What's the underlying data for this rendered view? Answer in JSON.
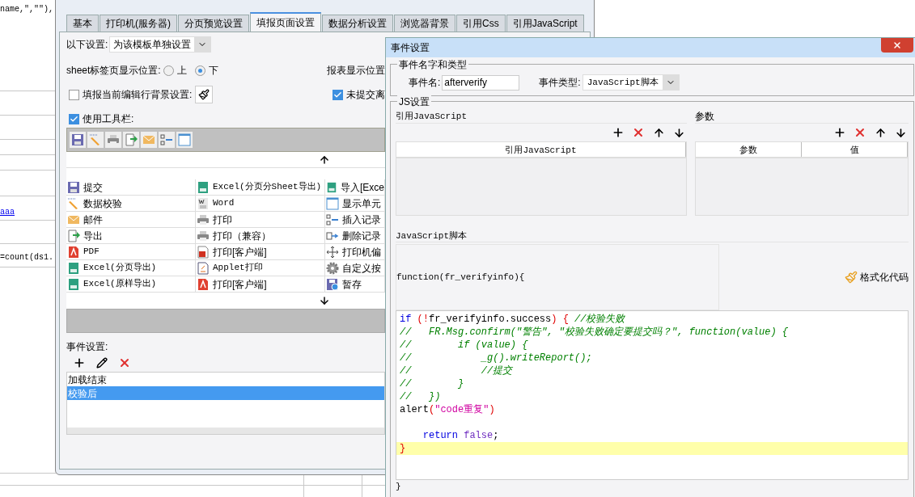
{
  "spreadsheet": {
    "cells": [
      {
        "text": "name,\",\"\"),",
        "kind": "formula"
      },
      {
        "text": "aaa",
        "kind": "link"
      },
      {
        "text": "=count(ds1.",
        "kind": "formula"
      }
    ]
  },
  "settings_window": {
    "tabs": [
      {
        "label": "基本",
        "selected": false
      },
      {
        "label": "打印机(服务器)",
        "selected": false
      },
      {
        "label": "分页预览设置",
        "selected": false
      },
      {
        "label": "填报页面设置",
        "selected": true
      },
      {
        "label": "数据分析设置",
        "selected": false
      },
      {
        "label": "浏览器背景",
        "selected": false
      },
      {
        "label": "引用Css",
        "selected": false
      },
      {
        "label": "引用JavaScript",
        "selected": false
      }
    ],
    "scope": {
      "label": "以下设置:",
      "value": "为该模板单独设置"
    },
    "sheet_tab_position": {
      "label": "sheet标签页显示位置:",
      "options": [
        {
          "label": "上",
          "selected": false
        },
        {
          "label": "下",
          "selected": true
        }
      ]
    },
    "report_position_label": "报表显示位置",
    "row_background": {
      "label": "填报当前编辑行背景设置:",
      "checked": false
    },
    "unsubmitted": {
      "label": "未提交离",
      "checked": true
    },
    "use_toolbar": {
      "label": "使用工具栏:",
      "checked": true
    },
    "buttons": [
      {
        "text": "提交",
        "kind": "save"
      },
      {
        "text": "Excel(分页分Sheet导出)",
        "kind": "excel"
      },
      {
        "text": "导入[Exce",
        "kind": "excel"
      },
      {
        "text": "数据校验",
        "kind": "check"
      },
      {
        "text": "Word",
        "kind": "word"
      },
      {
        "text": "显示单元",
        "kind": "cell"
      },
      {
        "text": "邮件",
        "kind": "mail"
      },
      {
        "text": "打印",
        "kind": "print"
      },
      {
        "text": "插入记录",
        "kind": "insert"
      },
      {
        "text": "导出",
        "kind": "export"
      },
      {
        "text": "打印（兼容）",
        "kind": "print"
      },
      {
        "text": "删除记录",
        "kind": "delete"
      },
      {
        "text": "PDF",
        "kind": "pdf"
      },
      {
        "text": "打印[客户端]",
        "kind": "flash"
      },
      {
        "text": "打印机偏",
        "kind": "move"
      },
      {
        "text": "Excel(分页导出)",
        "kind": "excel"
      },
      {
        "text": "Applet打印",
        "kind": "applet"
      },
      {
        "text": "自定义按",
        "kind": "gear"
      },
      {
        "text": "Excel(原样导出)",
        "kind": "excel"
      },
      {
        "text": "打印[客户端]",
        "kind": "pdf"
      },
      {
        "text": "暂存",
        "kind": "draft"
      }
    ],
    "events": {
      "label": "事件设置:",
      "items": [
        {
          "text": "加载结束",
          "selected": false
        },
        {
          "text": "校验后",
          "selected": true
        }
      ]
    }
  },
  "event_dialog": {
    "title": "事件设置",
    "name_type_group": {
      "title": "事件名字和类型",
      "name_label": "事件名:",
      "name_value": "afterverify",
      "type_label": "事件类型:",
      "type_value": "JavaScript脚本"
    },
    "js_group": {
      "title": "JS设置",
      "references": {
        "title": "引用JavaScript",
        "columns": [
          "引用JavaScript"
        ]
      },
      "parameters": {
        "title": "参数",
        "columns": [
          "参数",
          "值"
        ]
      }
    },
    "script": {
      "title": "JavaScript脚本",
      "header": "function(fr_verifyinfo){",
      "format_button": "格式化代码",
      "lines": [
        {
          "highlighted": false,
          "tokens": [
            {
              "text": "if",
              "kind": "keyword"
            },
            {
              "text": " (!",
              "kind": "punct"
            },
            {
              "text": "fr_verifyinfo.success",
              "kind": "plain"
            },
            {
              "text": ") { ",
              "kind": "punct"
            },
            {
              "text": "//校验失败",
              "kind": "comment"
            }
          ]
        },
        {
          "highlighted": false,
          "tokens": [
            {
              "text": "//   FR.Msg.confirm(\"警告\", \"校验失败确定要提交吗？\", function(value) {",
              "kind": "comment"
            }
          ]
        },
        {
          "highlighted": false,
          "tokens": [
            {
              "text": "//        if (value) {",
              "kind": "comment"
            }
          ]
        },
        {
          "highlighted": false,
          "tokens": [
            {
              "text": "//            _g().writeReport();",
              "kind": "comment"
            }
          ]
        },
        {
          "highlighted": false,
          "tokens": [
            {
              "text": "//            //提交",
              "kind": "comment"
            }
          ]
        },
        {
          "highlighted": false,
          "tokens": [
            {
              "text": "//        }",
              "kind": "comment"
            }
          ]
        },
        {
          "highlighted": false,
          "tokens": [
            {
              "text": "//   })",
              "kind": "comment"
            }
          ]
        },
        {
          "highlighted": false,
          "tokens": [
            {
              "text": "alert",
              "kind": "plain"
            },
            {
              "text": "(",
              "kind": "punct"
            },
            {
              "text": "\"code重复\"",
              "kind": "string"
            },
            {
              "text": ")",
              "kind": "punct"
            }
          ]
        },
        {
          "highlighted": false
        },
        {
          "highlighted": false,
          "tokens": [
            {
              "text": "    return",
              "kind": "keyword"
            },
            {
              "text": " false",
              "kind": "constant"
            },
            {
              "text": ";",
              "kind": "plain"
            }
          ]
        },
        {
          "highlighted": true,
          "tokens": [
            {
              "text": "}",
              "kind": "punct"
            }
          ]
        }
      ],
      "footer": "}"
    }
  }
}
